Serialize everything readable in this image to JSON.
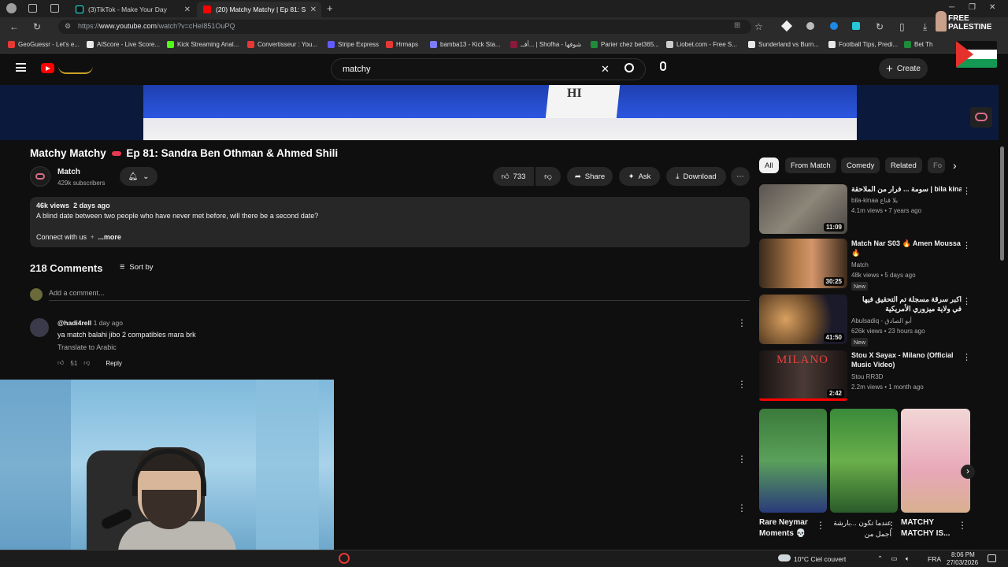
{
  "browser": {
    "tabs": [
      {
        "label": "(3)TikTok - Make Your Day"
      },
      {
        "label": "(20) Matchy Matchy | Ep 81: S"
      }
    ],
    "url_prefix": "https://",
    "url_domain": "www.youtube.com",
    "url_path": "/watch?v=cHeI851OuPQ",
    "bookmarks": [
      {
        "label": "GeoGuessr - Let's e...",
        "color": "#e53935"
      },
      {
        "label": "AIScore - Live Score...",
        "color": "#e8e8e8"
      },
      {
        "label": "Kick Streaming Anal...",
        "color": "#53fc18"
      },
      {
        "label": "Convertisseur : You...",
        "color": "#e53935"
      },
      {
        "label": "Stripe Express",
        "color": "#635bff"
      },
      {
        "label": "Hrmaps",
        "color": "#e53935"
      },
      {
        "label": "bamba13 - Kick Sta...",
        "color": "#7c7cff"
      },
      {
        "label": "أفــ... | Shofha - شوفها",
        "color": "#8b1a3a"
      },
      {
        "label": "Parier chez bet365...",
        "color": "#1e8c3a"
      },
      {
        "label": "Liobet.com - Free S...",
        "color": "#cccccc"
      },
      {
        "label": "Sunderland vs Burn...",
        "color": "#e8e8e8"
      },
      {
        "label": "Football Tips, Predi...",
        "color": "#e8e8e8"
      },
      {
        "label": "Bet Th",
        "color": "#1e8c3a"
      }
    ]
  },
  "header": {
    "search_value": "matchy",
    "create_label": "Create"
  },
  "video": {
    "card_text": "HI",
    "title_prefix": "Matchy Matchy",
    "title_suffix": "Ep 81: Sandra Ben Othman & Ahmed Shili",
    "channel_name": "Match",
    "subscribers": "429k subscribers",
    "likes": "733",
    "share_label": "Share",
    "ask_label": "Ask",
    "download_label": "Download",
    "views": "46k views",
    "posted": "2 days ago",
    "description": "A blind date between two people who have never met before, will there be a second date?",
    "connect_label": "Connect with us",
    "more_label": "...more"
  },
  "comments": {
    "count_label": "218 Comments",
    "sort_label": "Sort by",
    "add_placeholder": "Add a comment...",
    "items": [
      {
        "user": "@hadi4rell",
        "time": "1 day ago",
        "text": "ya match balahi jibo 2 compatibles mara brk",
        "translate": "Translate to Arabic",
        "likes": "51",
        "reply": "Reply"
      }
    ]
  },
  "sidebar": {
    "chips": [
      "All",
      "From Match",
      "Comedy",
      "Related",
      "Fo"
    ],
    "recommendations": [
      {
        "title": "سومة ... فرار من الملاحقة | bila kinaa",
        "channel": "bila-kinaa بلا قناع",
        "meta": "4.1m views • 7 years ago",
        "duration": "11:09",
        "new": ""
      },
      {
        "title": "Match Nar S03 🔥 Amen Moussa 🔥",
        "channel": "Match",
        "meta": "48k views • 5 days ago",
        "duration": "30:25",
        "new": "New"
      },
      {
        "title": "اكبر سرقة مسجلة تم التحقيق فيها في ولاية ميزوري الأمريكية",
        "channel": "Abulsadiq - أبو الصادق",
        "meta": "626k views • 23 hours ago",
        "duration": "41:50",
        "new": "New"
      },
      {
        "title": "Stou X Sayax - Milano (Official Music Video)",
        "channel": "Stou RR3D",
        "meta": "2.2m views • 1 month ago",
        "duration": "2:42",
        "new": ""
      }
    ],
    "thumb_text_milano": "MILANO",
    "shorts": [
      {
        "title": "Rare Neymar Moments 💀"
      },
      {
        "title": "عندما تكون ...بارشة أجمل من"
      },
      {
        "title": "MATCHY MATCHY IS..."
      }
    ]
  },
  "overlay": {
    "free_palestine": "FREE PALESTINE"
  },
  "taskbar": {
    "weather": "10°C  Ciel couvert",
    "lang": "FRA",
    "time": "8:06 PM",
    "date": "27/03/2026"
  }
}
